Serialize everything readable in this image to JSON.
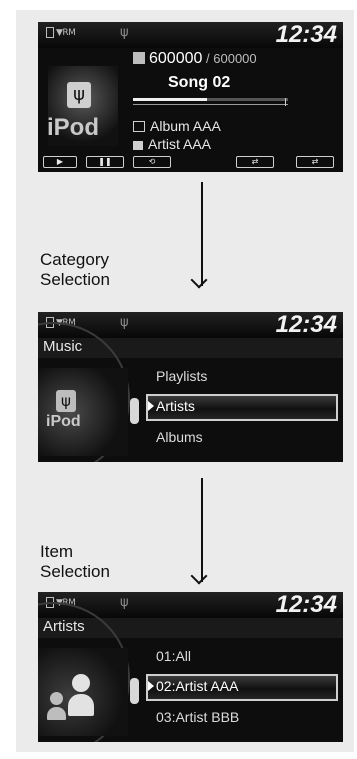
{
  "clock": "12:34",
  "status": {
    "signal": "RM"
  },
  "player": {
    "track_counter": "600000",
    "track_separator": "/",
    "track_total": "600000",
    "song": "Song 02",
    "album": "Album AAA",
    "artist": "Artist AAA",
    "source_logo": "iPod",
    "controls": [
      {
        "label": "▶",
        "icon": "play-icon"
      },
      {
        "label": "❚❚",
        "icon": "pause-icon"
      },
      {
        "label": "⟲",
        "icon": "repeat-icon"
      },
      {
        "label": "⇄",
        "icon": "shuffle-icon"
      },
      {
        "label": "⇄",
        "icon": "shuffle-all-icon"
      }
    ]
  },
  "step1_label": [
    "Category",
    "Selection"
  ],
  "category_screen": {
    "title": "Music",
    "source_logo": "iPod",
    "items": [
      "Playlists",
      "Artists",
      "Albums"
    ],
    "selected": "Artists"
  },
  "step2_label": [
    "Item",
    "Selection"
  ],
  "item_screen": {
    "title": "Artists",
    "items": [
      "01:All",
      "02:Artist AAA",
      "03:Artist BBB"
    ],
    "selected": "02:Artist AAA"
  }
}
